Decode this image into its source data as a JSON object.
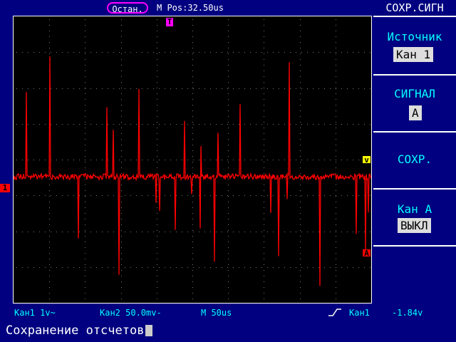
{
  "top": {
    "stop_label": "Остан.",
    "mpos": "M Pos:32.50us",
    "menu_title": "СОХР.СИГН"
  },
  "side": {
    "source_label": "Источник",
    "source_value": "Кан 1",
    "signal_label": "СИГНАЛ",
    "signal_value": "А",
    "save_label": "СОХР.",
    "chA_label": "Кан А",
    "chA_value": "ВЫКЛ"
  },
  "status": {
    "ch1": "Кан1  1v~",
    "ch2": "Кан2  50.0mv-",
    "timebase": "M 50us",
    "trigger_channel": "Кан1",
    "trigger_level": "-1.84v"
  },
  "footer": {
    "text": "Сохранение отсчетов"
  },
  "markers": {
    "trigger_pos": "T",
    "ch1": "1",
    "level": "v",
    "a": "A"
  },
  "colors": {
    "trace": "#ff0000",
    "screen_bg": "#000000",
    "panel_bg": "#000080",
    "accent": "#00ffff"
  }
}
